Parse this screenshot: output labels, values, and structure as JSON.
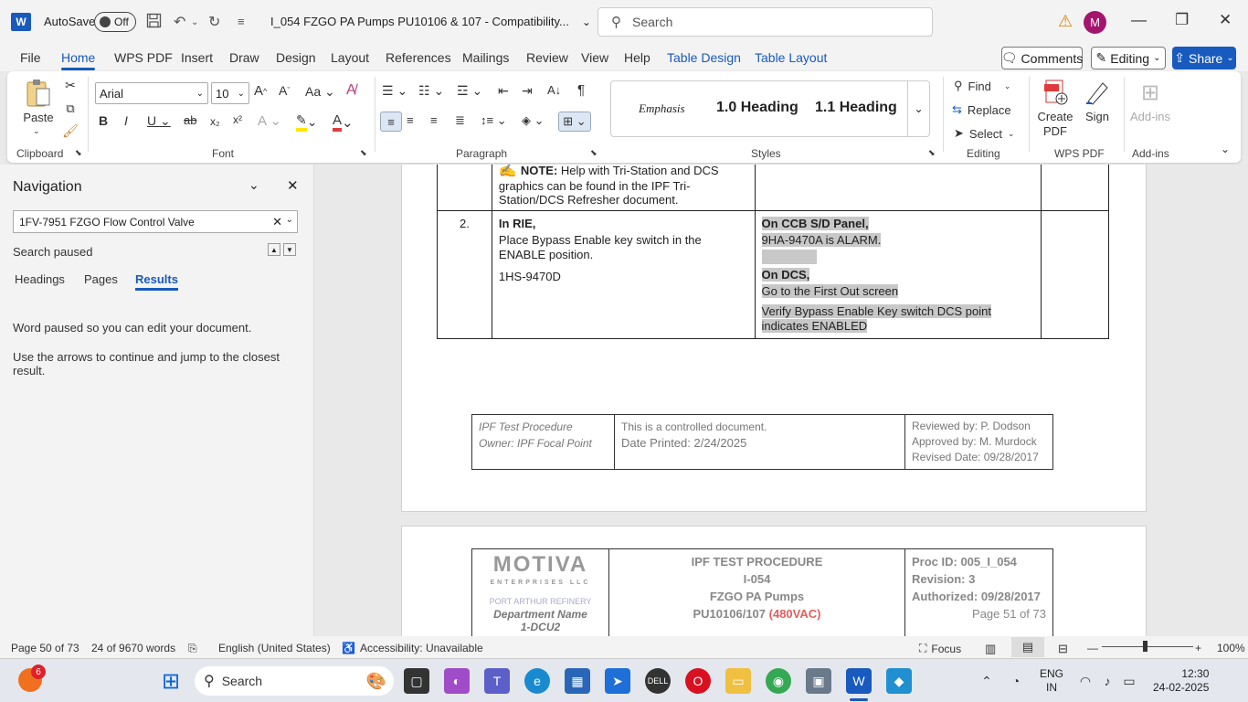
{
  "titlebar": {
    "app_logo": "W",
    "autosave_label": "AutoSave",
    "autosave_state": "Off",
    "doc_title": "I_054 FZGO PA Pumps PU10106 & 107  -  Compatibility...",
    "search_placeholder": "Search",
    "avatar_initial": "M"
  },
  "menubar": {
    "tabs": [
      "File",
      "Home",
      "WPS PDF",
      "Insert",
      "Draw",
      "Design",
      "Layout",
      "References",
      "Mailings",
      "Review",
      "View",
      "Help",
      "Table Design",
      "Table Layout"
    ],
    "comments_label": "Comments",
    "editing_label": "Editing",
    "share_label": "Share"
  },
  "ribbon": {
    "paste_label": "Paste",
    "clipboard_label": "Clipboard",
    "font_name": "Arial",
    "font_size": "10",
    "font_label": "Font",
    "paragraph_label": "Paragraph",
    "styles": [
      "Emphasis",
      "1.0  Heading",
      "1.1  Heading"
    ],
    "styles_label": "Styles",
    "find_label": "Find",
    "replace_label": "Replace",
    "select_label": "Select",
    "editing_group_label": "Editing",
    "create_pdf_label": "Create PDF",
    "sign_label": "Sign",
    "wps_pdf_label": "WPS PDF",
    "addins_label": "Add-ins",
    "addins_group_label": "Add-ins"
  },
  "navigation": {
    "title": "Navigation",
    "search_value": "1FV-7951 FZGO Flow Control Valve",
    "status": "Search paused",
    "tabs": [
      "Headings",
      "Pages",
      "Results"
    ],
    "msg1": "Word paused so you can edit your document.",
    "msg2": "Use the arrows to continue and jump to the closest result."
  },
  "document": {
    "note_bold": "NOTE:",
    "note_text": " Help with Tri-Station and DCS graphics can be found in the IPF Tri-Station/DCS Refresher document.",
    "step_num": "2.",
    "step_heading": "In RIE,",
    "step_line1": "Place Bypass Enable key switch in the ENABLE position.",
    "step_tag": "1HS-9470D",
    "verify_heading1": "On CCB S/D Panel,",
    "verify_line1": "9HA-9470A is ALARM.",
    "verify_heading2": "On DCS,",
    "verify_line2": "Go to the First Out screen",
    "verify_line3": "Verify Bypass Enable Key switch DCS point indicates ENABLED",
    "footer": {
      "f1": "IPF Test Procedure",
      "f2": "Owner: IPF Focal Point",
      "f3": "This is a controlled document.",
      "f4": "Date Printed: 2/24/2025",
      "f5": "Reviewed by: P. Dodson",
      "f6": "Approved by: M. Murdock",
      "f7": "Revised Date: 09/28/2017"
    },
    "header": {
      "logo": "MOTIVA",
      "logo_sub": "ENTERPRISES LLC",
      "refinery": "PORT ARTHUR REFINERY",
      "dept": "Department Name",
      "dept_val": "1-DCU2",
      "h1": "IPF TEST PROCEDURE",
      "h2": "I-054",
      "h3": "FZGO PA Pumps",
      "h4": "PU10106/107",
      "h4_red": "(480VAC)",
      "proc_id": "Proc ID: 005_I_054",
      "revision": "Revision: 3",
      "authorized": "Authorized: 09/28/2017",
      "page": "Page 51 of 73"
    }
  },
  "statusbar": {
    "page": "Page 50 of 73",
    "words": "24 of 9670 words",
    "language": "English (United States)",
    "accessibility": "Accessibility: Unavailable",
    "focus": "Focus",
    "zoom": "100%"
  },
  "taskbar": {
    "badge": "6",
    "search": "Search",
    "lang1": "ENG",
    "lang2": "IN",
    "time": "12:30",
    "date": "24-02-2025"
  },
  "colors": {
    "accent": "#185abd",
    "highlight": "#c8c8c8",
    "warn": "#d48a00",
    "red": "#e03a3a"
  }
}
